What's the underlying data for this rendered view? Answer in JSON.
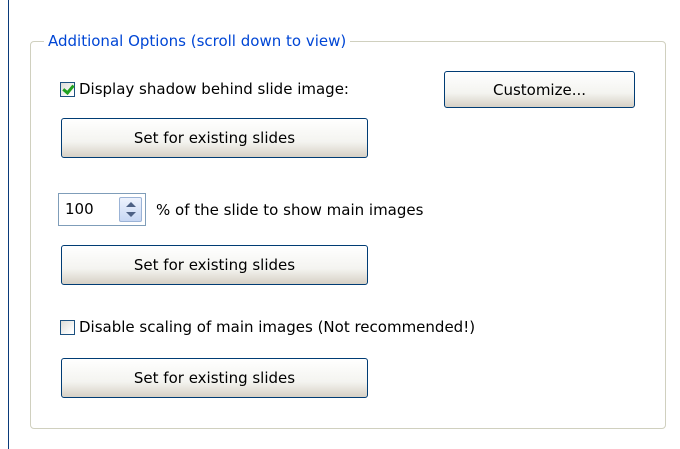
{
  "group": {
    "title": "Additional Options (scroll down to view)"
  },
  "shadow": {
    "checked": true,
    "label": "Display shadow behind slide image:",
    "customize_label": "Customize...",
    "set_existing_label": "Set for existing slides"
  },
  "main_images_percent": {
    "value": "100",
    "label": "% of the slide to show main images",
    "set_existing_label": "Set for existing slides"
  },
  "disable_scaling": {
    "checked": false,
    "label": "Disable scaling of main images (Not recommended!)",
    "set_existing_label": "Set for existing slides"
  },
  "colors": {
    "group_title": "#0046d5",
    "button_border": "#003c74",
    "checkmark": "#21a121"
  }
}
